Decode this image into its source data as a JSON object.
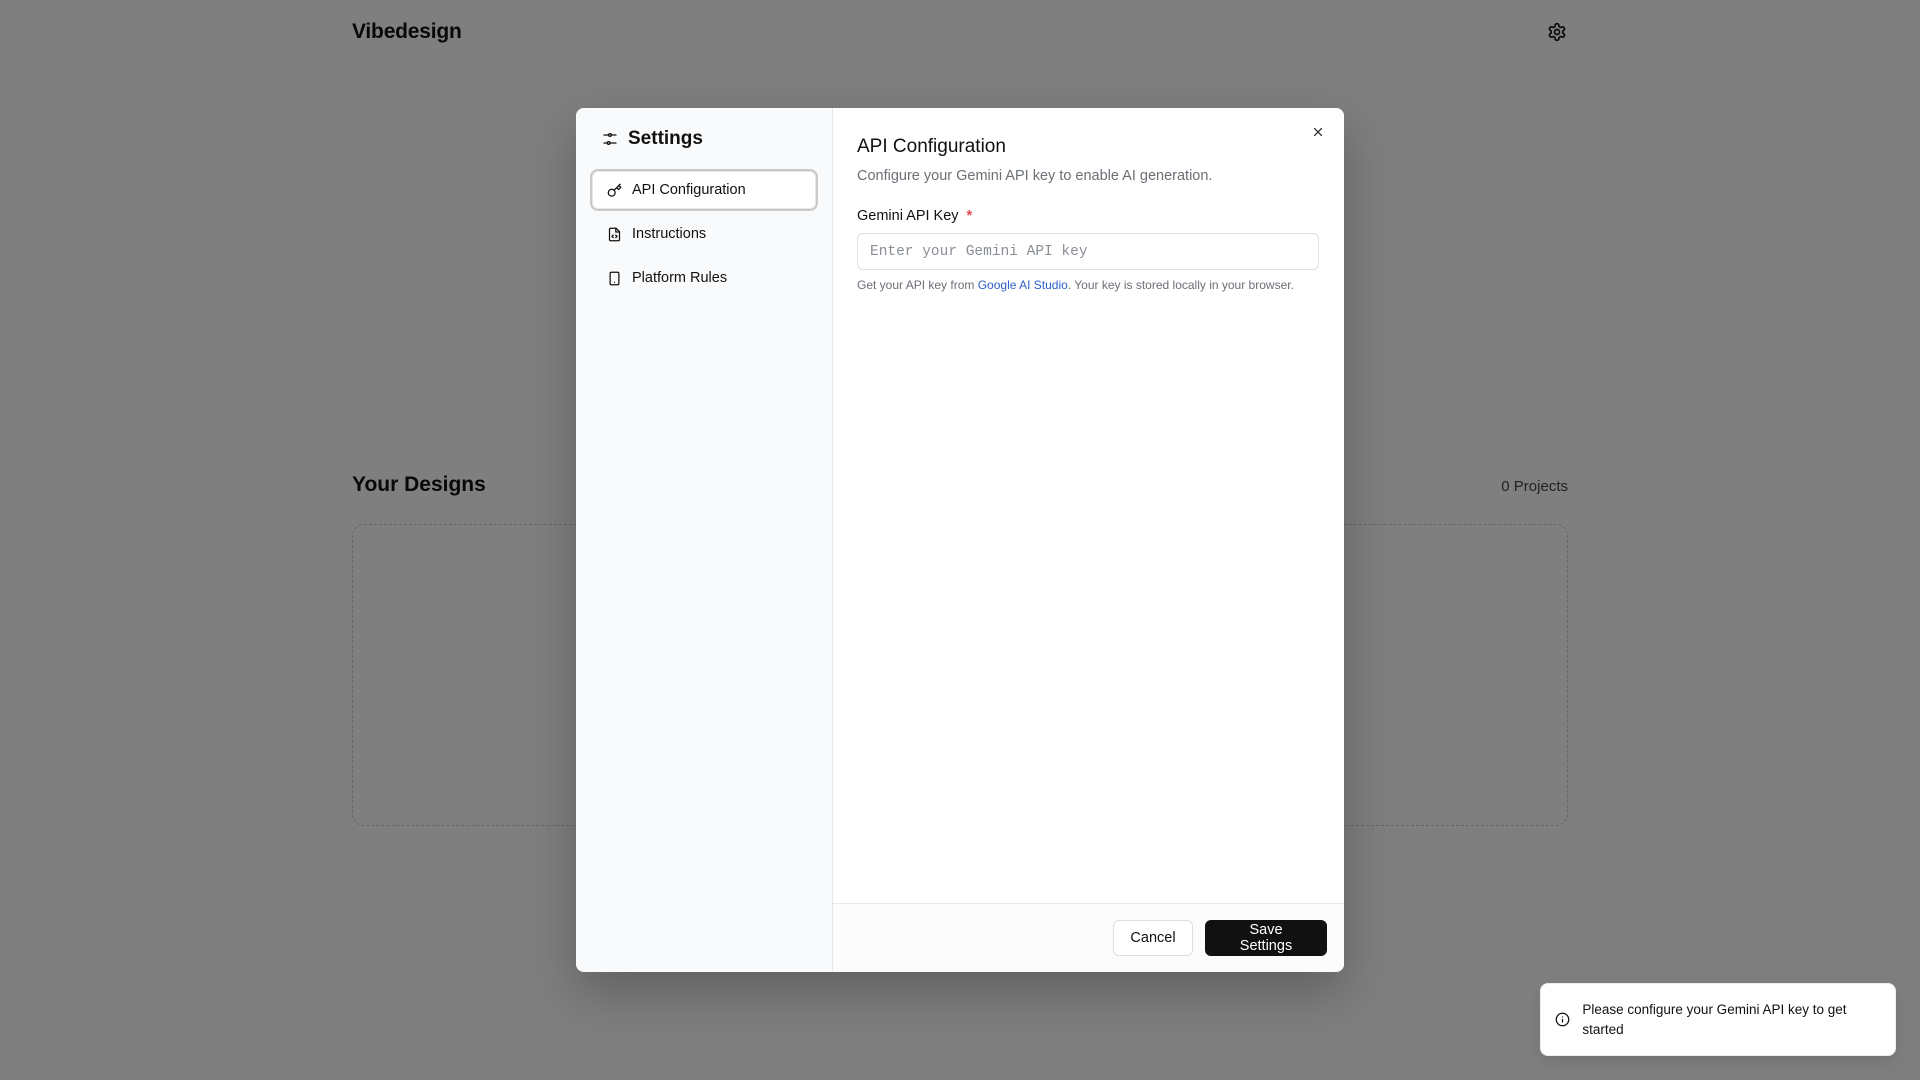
{
  "app": {
    "brand": "Vibedesign",
    "settings_icon": "gear-icon"
  },
  "designs": {
    "title": "Your Designs",
    "count": "0 Projects"
  },
  "modal": {
    "sidebar": {
      "title": "Settings",
      "title_icon": "sliders-icon",
      "items": [
        {
          "label": "API Configuration",
          "icon": "key-icon",
          "active": true
        },
        {
          "label": "Instructions",
          "icon": "file-code-icon",
          "active": false
        },
        {
          "label": "Platform Rules",
          "icon": "smartphone-icon",
          "active": false
        }
      ]
    },
    "main": {
      "title": "API Configuration",
      "description": "Configure your Gemini API key to enable AI generation.",
      "field_label": "Gemini API Key",
      "required_mark": "*",
      "input_value": "",
      "input_placeholder": "Enter your Gemini API key",
      "helper_prefix": "Get your API key from ",
      "helper_link": "Google AI Studio",
      "helper_suffix": ". Your key is stored locally in your browser."
    },
    "footer": {
      "cancel_label": "Cancel",
      "save_label": "Save Settings"
    }
  },
  "toast": {
    "icon": "info-icon",
    "message": "Please configure your Gemini API key to get started"
  },
  "colors": {
    "overlay": "#000000",
    "primary_button": "#111111",
    "link": "#2e5fcb",
    "required": "#e5484d"
  }
}
